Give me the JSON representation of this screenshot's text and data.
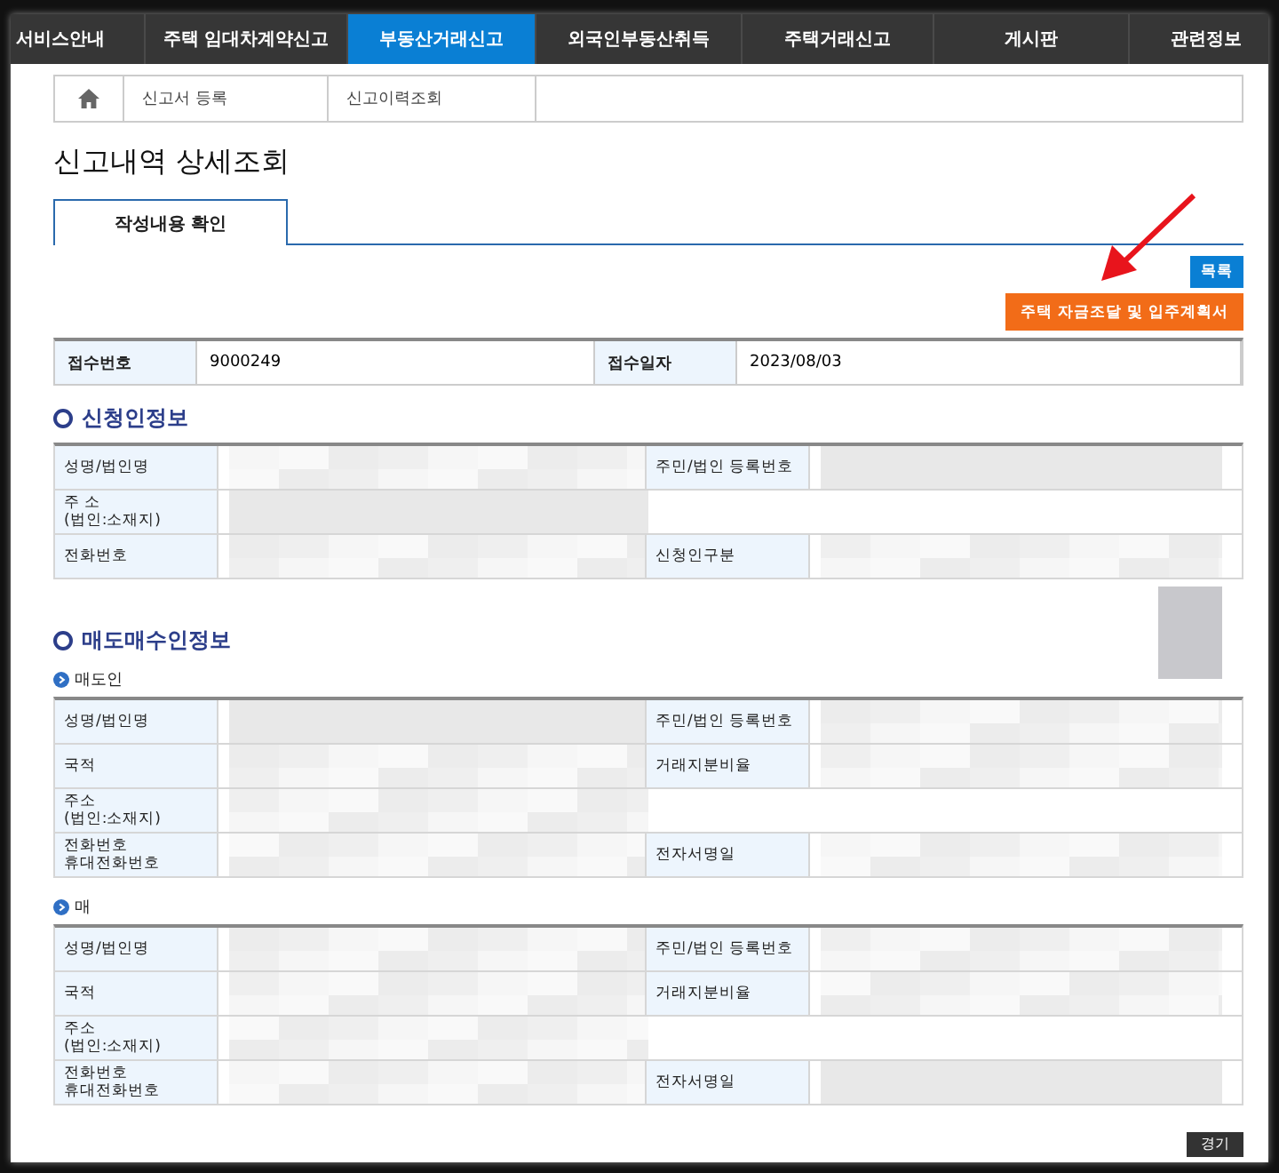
{
  "nav": [
    {
      "label": "서비스안내",
      "selected": false
    },
    {
      "label": "주택 임대차계약신고",
      "selected": false
    },
    {
      "label": "부동산거래신고",
      "selected": true
    },
    {
      "label": "외국인부동산취득",
      "selected": false
    },
    {
      "label": "주택거래신고",
      "selected": false
    },
    {
      "label": "게시판",
      "selected": false
    },
    {
      "label": "관련정보",
      "selected": false
    }
  ],
  "breadcrumb": [
    "신고서 등록",
    "신고이력조회"
  ],
  "title": "신고내역 상세조회",
  "tabs": [
    {
      "label": "작성내용 확인",
      "selected": true
    }
  ],
  "list_button": "목록",
  "plan_button": "주택 자금조달 및 입주계획서",
  "receipt": [
    {
      "label": "접수번호",
      "value": "9000249"
    },
    {
      "label": "접수일자",
      "value": "2023/08/03"
    }
  ],
  "sections": [
    {
      "heading": "신청인정보",
      "groups": [
        {
          "rows": [
            [
              "성명/법인명",
              "주민/법인 등록번호"
            ],
            [
              "주  소\n(법인:소재지)"
            ],
            [
              "전화번호",
              "신청인구분"
            ]
          ]
        }
      ]
    },
    {
      "heading": "매도매수인정보",
      "groups": [
        {
          "subheading": "매도인",
          "rows": [
            [
              "성명/법인명",
              "주민/법인 등록번호"
            ],
            [
              "국적",
              "거래지분비율"
            ],
            [
              "주소\n(법인:소재지)"
            ],
            [
              "전화번호\n휴대전화번호",
              "전자서명일"
            ]
          ]
        },
        {
          "subheading": "매",
          "rows": [
            [
              "성명/법인명",
              "주민/법인 등록번호"
            ],
            [
              "국적",
              "거래지분비율"
            ],
            [
              "주소\n(법인:소재지)"
            ],
            [
              "전화번호\n휴대전화번호",
              "전자서명일"
            ]
          ]
        }
      ]
    }
  ],
  "bottom_button": "경기"
}
